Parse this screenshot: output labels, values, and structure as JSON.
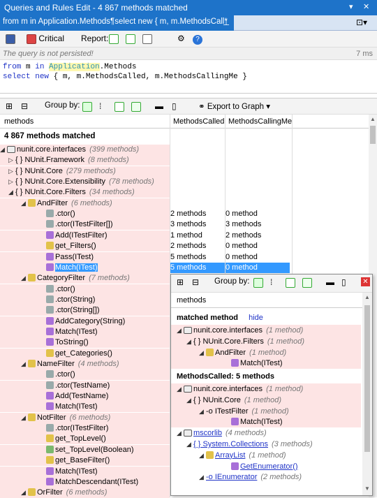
{
  "window": {
    "title": "Queries and Rules Edit - 4 867 methods matched",
    "controls": [
      "▾",
      "✕"
    ]
  },
  "tab": {
    "label": "from m in Application.Methods¶select new { m, m.MethodsCall*",
    "pin": "⊥",
    "close": "✕"
  },
  "toolbar1": {
    "critical": "Critical",
    "report": "Report:"
  },
  "status": {
    "message": "The query is not persisted!",
    "time": "7 ms"
  },
  "query": {
    "line1_kw": "from",
    "line1_a": " m ",
    "line1_in": "in",
    "line1_type": "Application",
    "line1_rest": ".Methods",
    "line2_kw1": "select",
    "line2_kw2": "new",
    "line2_rest": " { m, m.MethodsCalled, m.MethodsCallingMe }"
  },
  "toolbar2": {
    "group_by": "Group by:",
    "export": "Export to Graph",
    "export_arrow": "▾"
  },
  "columns": {
    "c1": "methods",
    "c2": "MethodsCalled",
    "c3": "MethodsCallingMe"
  },
  "matched_label": "4 867 methods matched",
  "rows": [
    {
      "indent": 6,
      "arrow": "◢",
      "icon": "m-ns",
      "name": "nunit.core.interfaces",
      "extra": "(399 methods)",
      "mc": "",
      "mcm": "",
      "pink": true
    },
    {
      "indent": 22,
      "arrow": "▷",
      "icon": "",
      "name": "{ } NUnit.Framework",
      "extra": "(8 methods)",
      "mc": "",
      "mcm": "",
      "pink": true
    },
    {
      "indent": 22,
      "arrow": "▷",
      "icon": "",
      "name": "{ } NUnit.Core",
      "extra": "(279 methods)",
      "mc": "",
      "mcm": "",
      "pink": true
    },
    {
      "indent": 22,
      "arrow": "▷",
      "icon": "",
      "name": "{ } NUnit.Core.Extensibility",
      "extra": "(78 methods)",
      "mc": "",
      "mcm": "",
      "pink": true
    },
    {
      "indent": 22,
      "arrow": "◢",
      "icon": "",
      "name": "{ } NUnit.Core.Filters",
      "extra": "(34 methods)",
      "mc": "",
      "mcm": "",
      "pink": true
    },
    {
      "indent": 40,
      "arrow": "◢",
      "icon": "m-yellow",
      "name": "AndFilter",
      "extra": "(6 methods)",
      "mc": "",
      "mcm": "",
      "pink": true
    },
    {
      "indent": 66,
      "arrow": "",
      "icon": "m-gray",
      "name": ".ctor()",
      "extra": "",
      "mc": "2 methods",
      "mcm": "0 method",
      "pink": true
    },
    {
      "indent": 66,
      "arrow": "",
      "icon": "m-gray",
      "name": ".ctor(ITestFilter[])",
      "extra": "",
      "mc": "3 methods",
      "mcm": "3 methods",
      "pink": true
    },
    {
      "indent": 66,
      "arrow": "",
      "icon": "m-purple",
      "name": "Add(ITestFilter)",
      "extra": "",
      "mc": "1 method",
      "mcm": "2 methods",
      "pink": true
    },
    {
      "indent": 66,
      "arrow": "",
      "icon": "m-yellow",
      "name": "get_Filters()",
      "extra": "",
      "mc": "2 methods",
      "mcm": "0 method",
      "pink": true
    },
    {
      "indent": 66,
      "arrow": "",
      "icon": "m-purple",
      "name": "Pass(ITest)",
      "extra": "",
      "mc": "5 methods",
      "mcm": "0 method",
      "pink": true
    },
    {
      "indent": 66,
      "arrow": "",
      "icon": "m-purple",
      "name": "Match(ITest)",
      "extra": "",
      "mc": "5 methods",
      "mcm": "0 method",
      "pink": true,
      "sel": true
    },
    {
      "indent": 40,
      "arrow": "◢",
      "icon": "m-yellow",
      "name": "CategoryFilter",
      "extra": "(7 methods)",
      "mc": "",
      "mcm": "",
      "pink": true
    },
    {
      "indent": 66,
      "arrow": "",
      "icon": "m-gray",
      "name": ".ctor()",
      "extra": "",
      "mc": "",
      "mcm": "",
      "pink": true
    },
    {
      "indent": 66,
      "arrow": "",
      "icon": "m-gray",
      "name": ".ctor(String)",
      "extra": "",
      "mc": "",
      "mcm": "",
      "pink": true
    },
    {
      "indent": 66,
      "arrow": "",
      "icon": "m-gray",
      "name": ".ctor(String[])",
      "extra": "",
      "mc": "",
      "mcm": "",
      "pink": true
    },
    {
      "indent": 66,
      "arrow": "",
      "icon": "m-purple",
      "name": "AddCategory(String)",
      "extra": "",
      "mc": "",
      "mcm": "",
      "pink": true
    },
    {
      "indent": 66,
      "arrow": "",
      "icon": "m-purple",
      "name": "Match(ITest)",
      "extra": "",
      "mc": "",
      "mcm": "",
      "pink": true
    },
    {
      "indent": 66,
      "arrow": "",
      "icon": "m-purple",
      "name": "ToString()",
      "extra": "",
      "mc": "",
      "mcm": "",
      "pink": true
    },
    {
      "indent": 66,
      "arrow": "",
      "icon": "m-yellow",
      "name": "get_Categories()",
      "extra": "",
      "mc": "",
      "mcm": "",
      "pink": true
    },
    {
      "indent": 40,
      "arrow": "◢",
      "icon": "m-yellow",
      "name": "NameFilter",
      "extra": "(4 methods)",
      "mc": "",
      "mcm": "",
      "pink": true
    },
    {
      "indent": 66,
      "arrow": "",
      "icon": "m-gray",
      "name": ".ctor()",
      "extra": "",
      "mc": "",
      "mcm": "",
      "pink": true
    },
    {
      "indent": 66,
      "arrow": "",
      "icon": "m-gray",
      "name": ".ctor(TestName)",
      "extra": "",
      "mc": "",
      "mcm": "",
      "pink": true
    },
    {
      "indent": 66,
      "arrow": "",
      "icon": "m-purple",
      "name": "Add(TestName)",
      "extra": "",
      "mc": "",
      "mcm": "",
      "pink": true
    },
    {
      "indent": 66,
      "arrow": "",
      "icon": "m-purple",
      "name": "Match(ITest)",
      "extra": "",
      "mc": "",
      "mcm": "",
      "pink": true
    },
    {
      "indent": 40,
      "arrow": "◢",
      "icon": "m-yellow",
      "name": "NotFilter",
      "extra": "(6 methods)",
      "mc": "",
      "mcm": "",
      "pink": true
    },
    {
      "indent": 66,
      "arrow": "",
      "icon": "m-gray",
      "name": ".ctor(ITestFilter)",
      "extra": "",
      "mc": "",
      "mcm": "",
      "pink": true
    },
    {
      "indent": 66,
      "arrow": "",
      "icon": "m-yellow",
      "name": "get_TopLevel()",
      "extra": "",
      "mc": "",
      "mcm": "",
      "pink": true
    },
    {
      "indent": 66,
      "arrow": "",
      "icon": "m-green",
      "name": "set_TopLevel(Boolean)",
      "extra": "",
      "mc": "",
      "mcm": "",
      "pink": true
    },
    {
      "indent": 66,
      "arrow": "",
      "icon": "m-yellow",
      "name": "get_BaseFilter()",
      "extra": "",
      "mc": "",
      "mcm": "",
      "pink": true
    },
    {
      "indent": 66,
      "arrow": "",
      "icon": "m-purple",
      "name": "Match(ITest)",
      "extra": "",
      "mc": "",
      "mcm": "",
      "pink": true
    },
    {
      "indent": 66,
      "arrow": "",
      "icon": "m-purple",
      "name": "MatchDescendant(ITest)",
      "extra": "",
      "mc": "",
      "mcm": "",
      "pink": true
    },
    {
      "indent": 40,
      "arrow": "◢",
      "icon": "m-yellow",
      "name": "OrFilter",
      "extra": "(6 methods)",
      "mc": "",
      "mcm": "",
      "pink": true
    }
  ],
  "popup": {
    "group_by": "Group by:",
    "close": "✕",
    "col": "methods",
    "matched": "matched method",
    "hide": "hide",
    "sec1": [
      {
        "indent": 8,
        "arrow": "◢",
        "icon": "m-ns",
        "name": "nunit.core.interfaces",
        "extra": "(1 method)",
        "link": false
      },
      {
        "indent": 22,
        "arrow": "◢",
        "icon": "",
        "name": "{ } NUnit.Core.Filters",
        "extra": "(1 method)",
        "link": false
      },
      {
        "indent": 40,
        "arrow": "◢",
        "icon": "m-yellow",
        "name": "AndFilter",
        "extra": "(1 method)",
        "link": false
      },
      {
        "indent": 76,
        "arrow": "",
        "icon": "m-purple",
        "name": "Match(ITest)",
        "extra": "",
        "link": false
      }
    ],
    "called_label": "MethodsCalled: 5 methods",
    "sec2": [
      {
        "indent": 8,
        "arrow": "◢",
        "icon": "m-ns",
        "name": "nunit.core.interfaces",
        "extra": "(1 method)",
        "link": false,
        "pink": true
      },
      {
        "indent": 22,
        "arrow": "◢",
        "icon": "",
        "name": "{ } NUnit.Core",
        "extra": "(1 method)",
        "link": false,
        "pink": true
      },
      {
        "indent": 40,
        "arrow": "◢",
        "icon": "",
        "name": "-o ITestFilter",
        "extra": "(1 method)",
        "link": false,
        "pink": true
      },
      {
        "indent": 76,
        "arrow": "",
        "icon": "m-purple",
        "name": "Match(ITest)",
        "extra": "",
        "link": false,
        "pink": true
      },
      {
        "indent": 8,
        "arrow": "◢",
        "icon": "m-ns",
        "name": "mscorlib",
        "extra": "(4 methods)",
        "link": true,
        "pink": false
      },
      {
        "indent": 22,
        "arrow": "◢",
        "icon": "",
        "name": "{ } System.Collections",
        "extra": "(3 methods)",
        "link": true,
        "pink": false
      },
      {
        "indent": 40,
        "arrow": "◢",
        "icon": "m-yellow",
        "name": "ArrayList",
        "extra": "(1 method)",
        "link": true,
        "pink": false
      },
      {
        "indent": 76,
        "arrow": "",
        "icon": "m-purple",
        "name": "GetEnumerator()",
        "extra": "",
        "link": true,
        "pink": false
      },
      {
        "indent": 40,
        "arrow": "◢",
        "icon": "",
        "name": "-o IEnumerator",
        "extra": "(2 methods)",
        "link": true,
        "pink": false
      }
    ]
  }
}
